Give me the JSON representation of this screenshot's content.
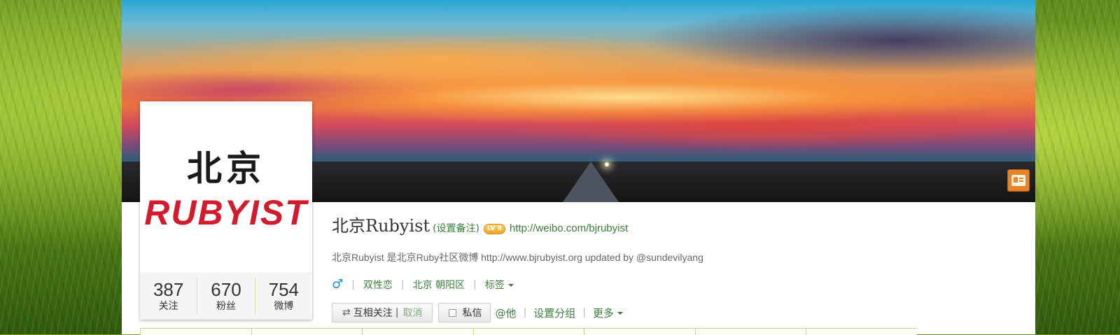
{
  "profile": {
    "name": "北京Rubyist",
    "remark_link": "(设置备注)",
    "level_badge": "LV 8",
    "url": "http://weibo.com/bjrubyist",
    "bio": "北京Rubyist 是北京Ruby社区微博 http://www.bjrubyist.org updated by @sundevilyang",
    "gender_symbol": "♂",
    "orientation": "双性恋",
    "location": "北京 朝阳区",
    "tags_label": "标签"
  },
  "avatar": {
    "line1": "北京",
    "line2": "RUBYIST"
  },
  "counts": [
    {
      "value": "387",
      "label": "关注"
    },
    {
      "value": "670",
      "label": "粉丝"
    },
    {
      "value": "754",
      "label": "微博"
    }
  ],
  "actions": {
    "mutual_follow": "互相关注",
    "mutual_sep": "|",
    "cancel": "取消",
    "message": "私信",
    "at_him": "@他",
    "set_group": "设置分组",
    "more": "更多"
  },
  "icons": {
    "mutual": "⇄",
    "card": "profile-card-icon"
  }
}
